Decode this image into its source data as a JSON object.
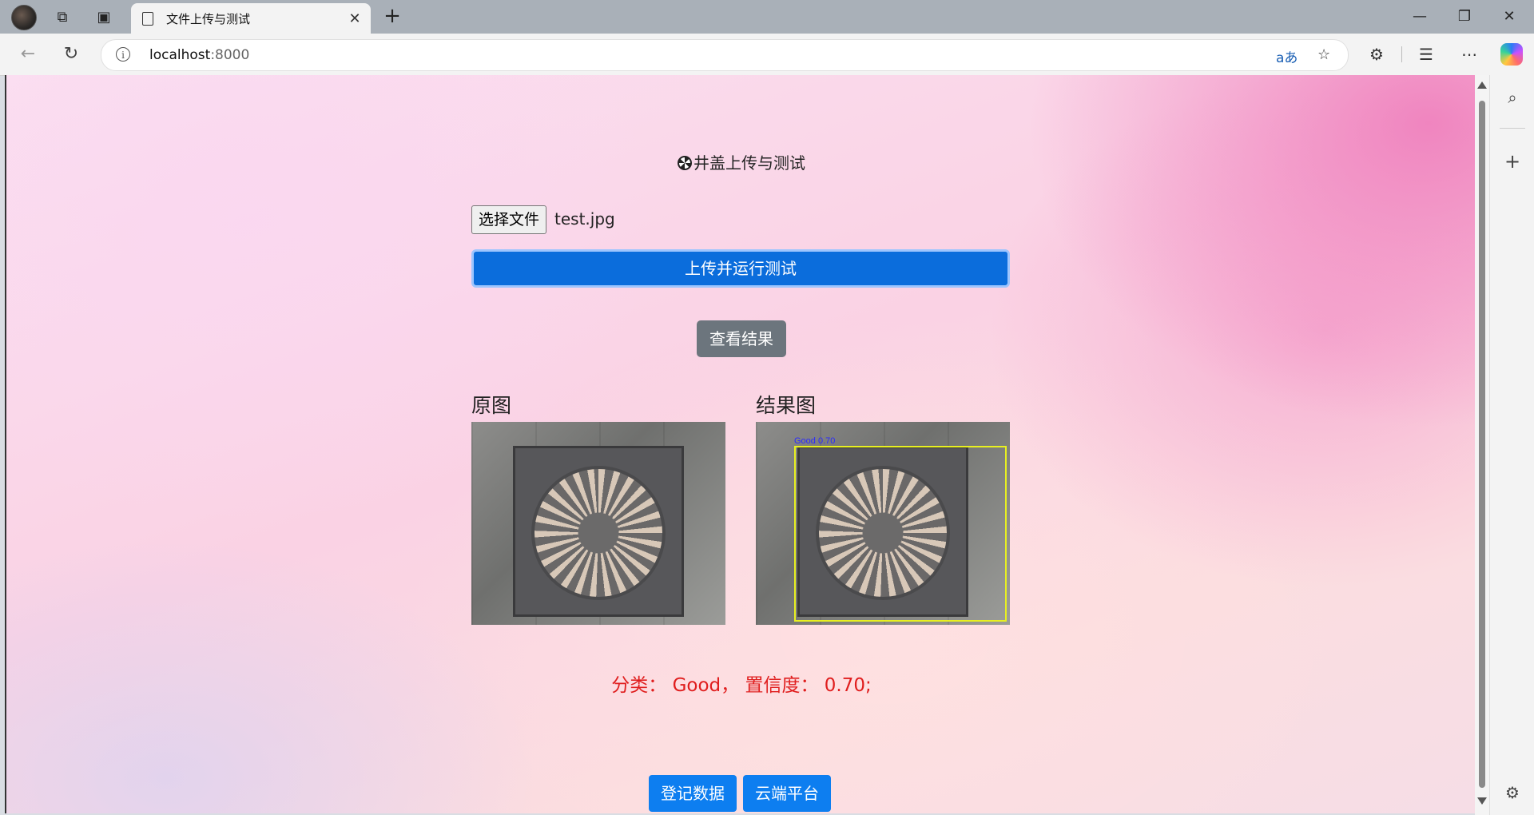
{
  "browser": {
    "tab_title": "文件上传与测试",
    "tab_close": "✕",
    "new_tab": "+",
    "url_host": "localhost",
    "url_port": ":8000",
    "icons": [
      "profile-avatar",
      "workspaces-icon",
      "tab-actions-icon",
      "page-icon",
      "back-icon",
      "refresh-icon",
      "info-icon",
      "read-aloud-icon",
      "favorite-star-icon",
      "extensions-icon",
      "favorites-icon",
      "more-icon",
      "copilot-icon",
      "search-icon",
      "add-icon",
      "settings-icon"
    ]
  },
  "page": {
    "title": "井盖上传与测试",
    "file_button": "选择文件",
    "file_name": "test.jpg",
    "upload_button": "上传并运行测试",
    "view_result_button": "查看结果",
    "original_label": "原图",
    "result_label": "结果图",
    "detect_label": "Good 0.70",
    "result_text": "分类： Good， 置信度： 0.70;",
    "register_button": "登记数据",
    "cloud_button": "云端平台"
  },
  "colors": {
    "primary": "#0b6ddc",
    "secondary": "#6c757d",
    "result_red": "#e01e1e",
    "box_yellow": "#e8f020"
  }
}
